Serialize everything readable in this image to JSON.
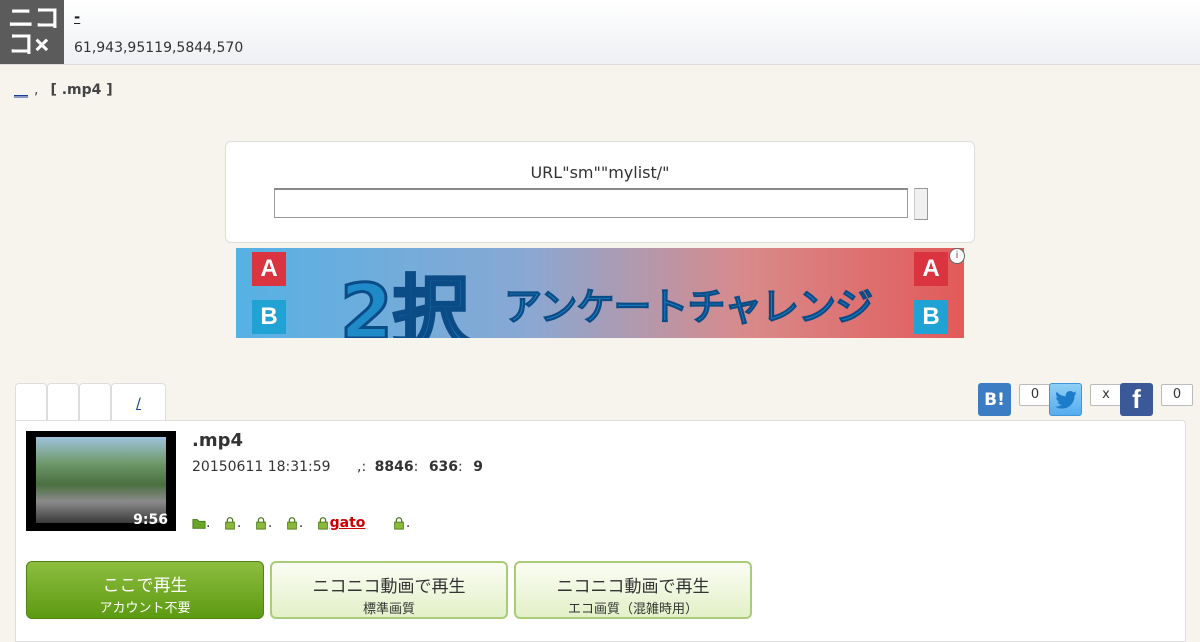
{
  "header": {
    "logo": "ニコ ×",
    "logo_chars": [
      "ニ",
      "コ",
      "コ",
      "×"
    ],
    "site_title": "-",
    "stats": "61,943,95119,5844,570"
  },
  "breadcrumb": {
    "link": "__",
    "separator": ",",
    "current": "[ .mp4 ]"
  },
  "search": {
    "hint": "URL\"sm\"\"mylist/\"",
    "value": ""
  },
  "banner": {
    "title_number": "2択",
    "subtitle": "アンケートチャレンジ",
    "left_top": "A",
    "left_bottom": "B",
    "right_top": "A",
    "right_bottom": "B",
    "info_icon": "i"
  },
  "tabs": [
    {
      "label": ""
    },
    {
      "label": ""
    },
    {
      "label": ""
    },
    {
      "label": "/"
    }
  ],
  "share": {
    "hatena_label": "B!",
    "hatena_count": "0",
    "twitter_count": "x",
    "facebook_label": "f",
    "facebook_count": "0"
  },
  "video": {
    "title": ".mp4",
    "duration": "9:56",
    "datetime": "20150611 18:31:59",
    "stat_sep": ",:",
    "views": "8846",
    "comments": "636",
    "mylists": "9",
    "colon": ":",
    "tags": [
      {
        "label": "."
      },
      {
        "label": "."
      },
      {
        "label": "."
      },
      {
        "label": "."
      },
      {
        "label": "gato",
        "linked": true
      },
      {
        "label": "."
      }
    ]
  },
  "play_buttons": [
    {
      "line1": "ここで再生",
      "line2": "アカウント不要"
    },
    {
      "line1": "ニコニコ動画で再生",
      "line2": "標準画質"
    },
    {
      "line1": "ニコニコ動画で再生",
      "line2": "エコ画質（混雑時用）"
    }
  ],
  "colors": {
    "accent_green": "#5c9a12",
    "tag_red": "#cc0000",
    "link_blue": "#1a3d9a",
    "twitter": "#55acee",
    "facebook": "#3b5998",
    "hatena": "#008fde"
  }
}
